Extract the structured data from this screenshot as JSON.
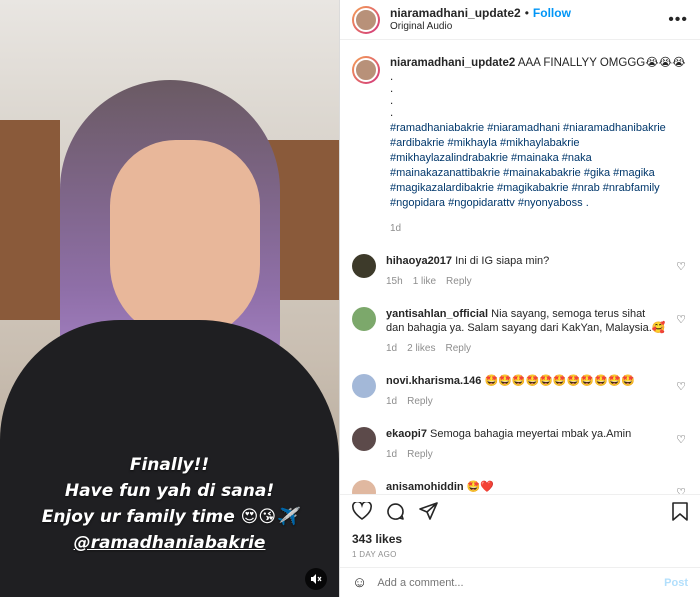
{
  "video": {
    "overlay_lines": [
      "Finally!!",
      "Have fun yah di sana!",
      "Enjoy ur family time 😍😘✈️",
      "@ramadhaniabakrie"
    ],
    "mute_icon": "speaker-muted-icon"
  },
  "header": {
    "username": "niaramadhani_update2",
    "separator": "•",
    "follow_label": "Follow",
    "audio_label": "Original Audio",
    "more_icon": "more-options-icon"
  },
  "post": {
    "username": "niaramadhani_update2",
    "caption": "AAA FINALLYY OMGGG😭😭😭",
    "dots": [
      ".",
      ".",
      ".",
      "."
    ],
    "hashtags": "#ramadhaniabakrie #niaramadhani #niaramadhanibakrie #ardibakrie #mikhayla #mikhaylabakrie #mikhaylazalindrabakrie #mainaka #naka #mainakazanattibakrie #mainakabakrie #gika #magika #magikazalardibakrie #magikabakrie #nrab #nrabfamily #ngopidara #ngopidarattv #nyonyaboss .",
    "age": "1d"
  },
  "comments": [
    {
      "username": "hihaoya2017",
      "text": "Ini di IG siapa min?",
      "age": "15h",
      "likes": "1 like",
      "reply": "Reply",
      "avatar_color": "#3d3a2a"
    },
    {
      "username": "yantisahlan_official",
      "text": "Nia sayang, semoga terus sihat dan bahagia ya. Salam sayang dari KakYan, Malaysia.🥰",
      "age": "1d",
      "likes": "2 likes",
      "reply": "Reply",
      "avatar_color": "#7ca86b"
    },
    {
      "username": "novi.kharisma.146",
      "text": "🤩🤩🤩🤩🤩🤩🤩🤩🤩🤩🤩",
      "age": "1d",
      "likes": "",
      "reply": "Reply",
      "avatar_color": "#a3b8d8"
    },
    {
      "username": "ekaopi7",
      "text": "Semoga bahagia meyertai mbak ya.Amin",
      "age": "1d",
      "likes": "",
      "reply": "Reply",
      "avatar_color": "#5c4a4a"
    },
    {
      "username": "anisamohiddin",
      "text": "🤩❤️",
      "age": "",
      "likes": "",
      "reply": "",
      "avatar_color": "#e0b8a0"
    }
  ],
  "actions": {
    "like_icon": "heart-icon",
    "comment_icon": "comment-icon",
    "share_icon": "share-icon",
    "save_icon": "bookmark-icon",
    "likes_count": "343 likes",
    "post_age": "1 DAY AGO"
  },
  "add_comment": {
    "emoji_icon": "emoji-icon",
    "placeholder": "Add a comment...",
    "post_label": "Post"
  },
  "colors": {
    "link": "#0095f6",
    "hashtag": "#00376b",
    "muted": "#8e8e8e"
  }
}
